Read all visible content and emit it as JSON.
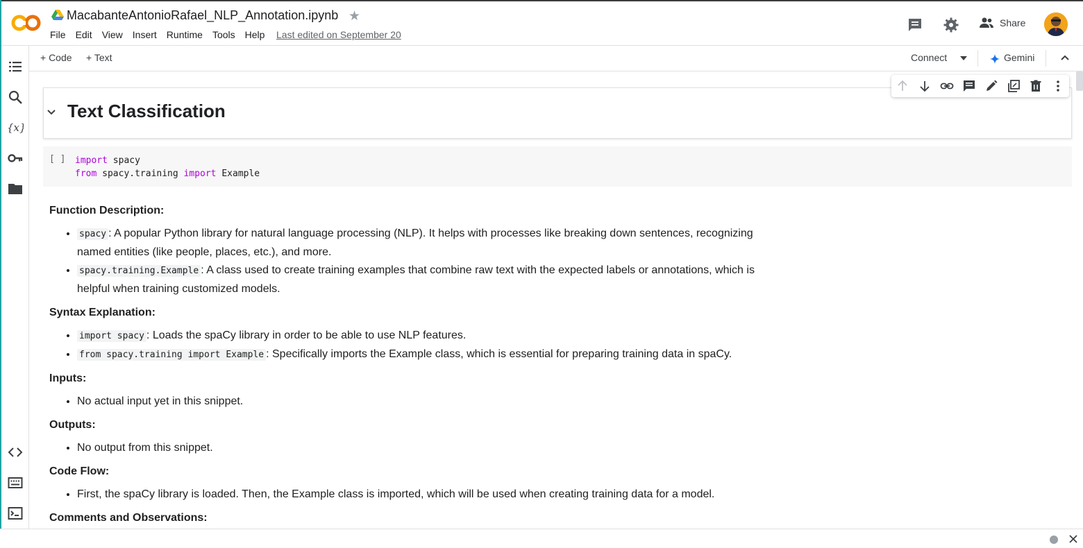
{
  "header": {
    "doc_title": "MacabanteAntonioRafael_NLP_Annotation.ipynb",
    "menu": [
      "File",
      "Edit",
      "View",
      "Insert",
      "Runtime",
      "Tools",
      "Help"
    ],
    "last_edited": "Last edited on September 20",
    "share_label": "Share",
    "logo_text": "CO"
  },
  "toolbar": {
    "add_code": "+ Code",
    "add_text": "+ Text",
    "connect": "Connect",
    "gemini": "Gemini"
  },
  "notebook": {
    "heading": "Text Classification",
    "code_cell": {
      "bracket": "[ ]",
      "lines": [
        {
          "parts": [
            {
              "kw": "import"
            },
            {
              "txt": " spacy"
            }
          ]
        },
        {
          "parts": [
            {
              "kw": "from"
            },
            {
              "txt": " spacy.training "
            },
            {
              "kw": "import"
            },
            {
              "txt": " Example"
            }
          ]
        }
      ]
    },
    "sections": [
      {
        "title": "Function Description:",
        "items": [
          {
            "code": "spacy",
            "text": ": A popular Python library for natural language processing (NLP). It helps with processes like breaking down sentences, recognizing named entities (like people, places, etc.), and more."
          },
          {
            "code": "spacy.training.Example",
            "text": ": A class used to create training examples that combine raw text with the expected labels or annotations, which is helpful when training customized models."
          }
        ]
      },
      {
        "title": "Syntax Explanation:",
        "items": [
          {
            "code": "import spacy",
            "text": ": Loads the spaCy library in order to be able to use NLP features."
          },
          {
            "code": "from spacy.training import Example",
            "text": ": Specifically imports the Example class, which is essential for preparing training data in spaCy."
          }
        ]
      },
      {
        "title": "Inputs:",
        "items": [
          {
            "code": "",
            "text": "No actual input yet in this snippet."
          }
        ]
      },
      {
        "title": "Outputs:",
        "items": [
          {
            "code": "",
            "text": "No output from this snippet."
          }
        ]
      },
      {
        "title": "Code Flow:",
        "items": [
          {
            "code": "",
            "text": "First, the spaCy library is loaded. Then, the Example class is imported, which will be used when creating training data for a model."
          }
        ]
      },
      {
        "title": "Comments and Observations:",
        "items": []
      }
    ]
  },
  "icons": {
    "header": [
      "comment-icon",
      "settings-icon",
      "people-icon"
    ],
    "rail": [
      "table-of-contents-icon",
      "search-icon",
      "variables-icon",
      "key-icon",
      "folder-icon",
      "code-snippets-icon",
      "command-palette-icon",
      "terminal-icon"
    ],
    "cell_toolbar": [
      "arrow-up-icon",
      "arrow-down-icon",
      "link-icon",
      "comment-icon",
      "edit-icon",
      "mirror-cell-icon",
      "delete-icon",
      "more-vert-icon"
    ]
  },
  "colors": {
    "brand_orange": "#f9ab00",
    "keyword": "#af00db",
    "gemini_blue": "#1a73e8"
  }
}
